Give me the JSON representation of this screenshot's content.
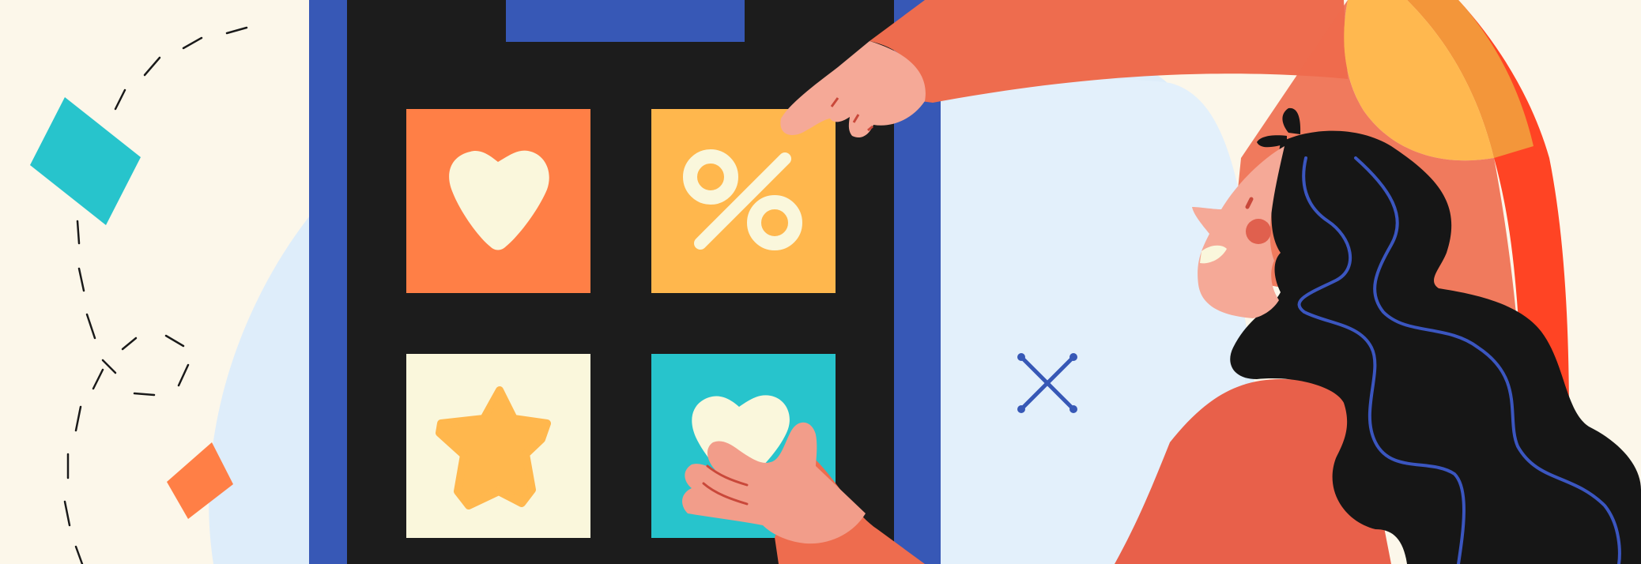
{
  "illustration": {
    "subject": "woman-tapping-app-tiles",
    "colors": {
      "cream": "#fcf7ea",
      "sky": "#dcecfb",
      "phone_frame": "#3758b6",
      "phone_screen": "#1c1c1c",
      "tile_orange": "#ff7f46",
      "tile_yellow": "#ffb74d",
      "tile_cream": "#faf7dc",
      "tile_teal": "#27c4cc",
      "sleeve": "#ee6c4e",
      "skin": "#f5a997",
      "hair": "#161616",
      "hair_accent": "#3b56c0",
      "sun": "#ffb84f",
      "sun_ray": "#f3963a",
      "ray_red": "#ff4424",
      "ink": "#1a1a1a"
    },
    "tiles": [
      {
        "name": "heart-tile",
        "icon": "heart-icon",
        "bg": "#ff7f46"
      },
      {
        "name": "percent-tile",
        "icon": "percent-icon",
        "bg": "#ffb74d"
      },
      {
        "name": "star-tile",
        "icon": "star-icon",
        "bg": "#faf7dc"
      },
      {
        "name": "heart-tile-teal",
        "icon": "heart-icon",
        "bg": "#27c4cc"
      }
    ]
  }
}
